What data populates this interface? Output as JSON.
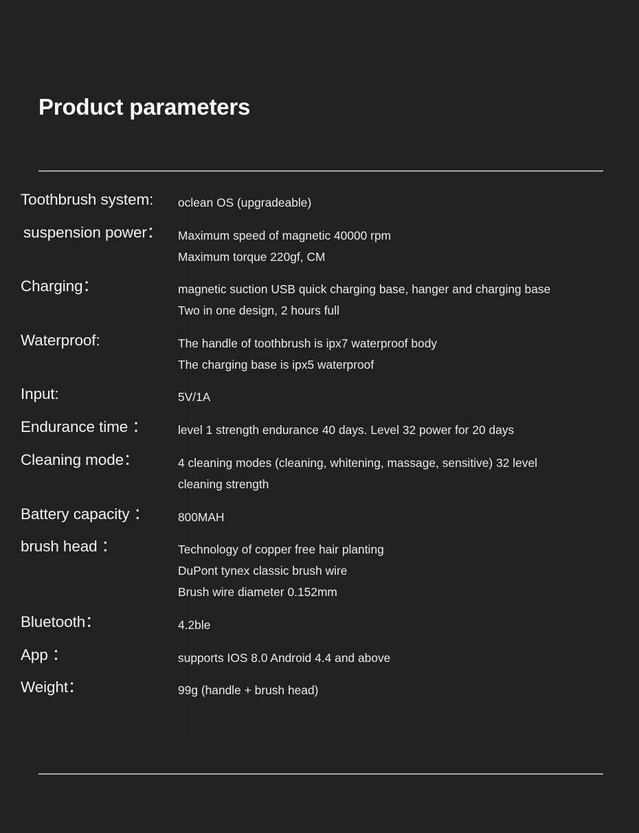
{
  "page": {
    "background_color": "#212121",
    "text_color": "#f4f4f4",
    "value_color": "#ececec",
    "rule_color": "#c9c9c9"
  },
  "title": "Product parameters",
  "specs": [
    {
      "label": "Toothbrush system:",
      "indent": false,
      "values": [
        "oclean OS (upgradeable)"
      ]
    },
    {
      "label": "suspension power：",
      "indent": true,
      "values": [
        "Maximum speed of magnetic 40000 rpm",
        "Maximum torque 220gf, CM"
      ]
    },
    {
      "label": "Charging：",
      "indent": false,
      "values": [
        "magnetic suction USB quick charging base, hanger and charging base",
        "Two in one design, 2 hours full"
      ]
    },
    {
      "label": "Waterproof:",
      "indent": false,
      "values": [
        "The handle of toothbrush is ipx7 waterproof body",
        "The charging base is ipx5 waterproof"
      ]
    },
    {
      "label": "Input:",
      "indent": false,
      "values": [
        "5V/1A"
      ]
    },
    {
      "label": "Endurance time ：",
      "indent": false,
      "values": [
        "level 1 strength endurance 40 days. Level 32 power for 20 days"
      ]
    },
    {
      "label": "Cleaning mode：",
      "indent": false,
      "values": [
        "4 cleaning modes (cleaning, whitening, massage, sensitive) 32 level",
        "cleaning strength"
      ]
    },
    {
      "label": "Battery capacity ：",
      "indent": false,
      "values": [
        "800MAH"
      ]
    },
    {
      "label": "brush head ：",
      "indent": false,
      "values": [
        "Technology of copper free hair planting",
        "DuPont tynex classic brush wire",
        "Brush wire diameter 0.152mm"
      ]
    },
    {
      "label": "Bluetooth：",
      "indent": false,
      "values": [
        "4.2ble"
      ]
    },
    {
      "label": "App ：",
      "indent": false,
      "values": [
        "supports IOS 8.0 Android 4.4 and above"
      ]
    },
    {
      "label": "Weight：",
      "indent": false,
      "values": [
        "99g (handle + brush head)"
      ]
    }
  ]
}
